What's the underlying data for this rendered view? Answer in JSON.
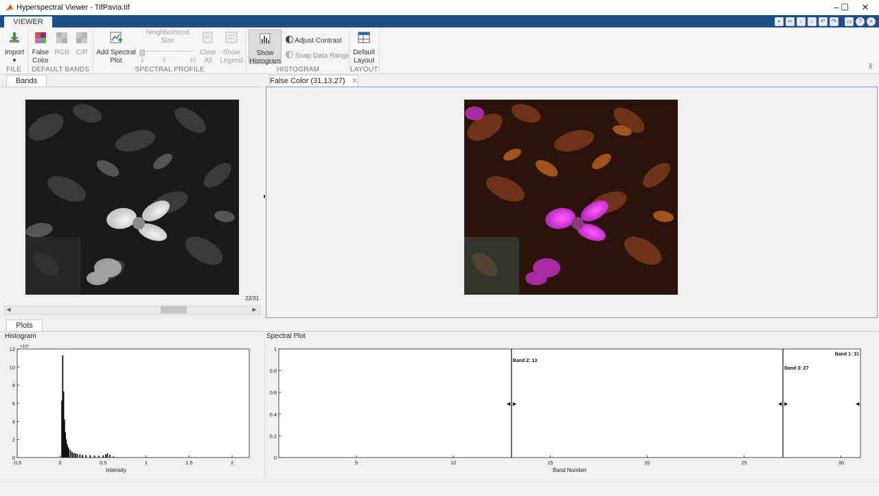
{
  "window": {
    "title": "Hyperspectral Viewer - TifPavia.tif",
    "controls": [
      "–",
      "☐",
      "✕"
    ]
  },
  "ribbon": {
    "tab": "VIEWER",
    "file": {
      "label": "FILE",
      "import_line1": "Import",
      "import_arrow": "▾"
    },
    "default_bands": {
      "label": "DEFAULT BANDS",
      "false_line1": "False",
      "false_line2": "Color",
      "rgb": "RGB",
      "cir": "CIR"
    },
    "spectral_profile": {
      "label": "SPECTRAL PROFILE",
      "add_line1": "Add Spectral",
      "add_line2": "Plot",
      "neigh_line1": "Neighborhood",
      "neigh_line2": "Size",
      "slider_ticks": [
        "1",
        "5",
        "10"
      ],
      "clear_line1": "Clear",
      "clear_line2": "All",
      "legend_line1": "Show",
      "legend_line2": "Legend"
    },
    "histogram": {
      "label": "HISTOGRAM",
      "show_line1": "Show",
      "show_line2": "Histogram",
      "adjust_contrast": "Adjust Contrast",
      "snap_range": "Snap Data Range"
    },
    "layout": {
      "label": "LAYOUT",
      "default_line1": "Default",
      "default_line2": "Layout"
    }
  },
  "bands_panel": {
    "tab": "Bands",
    "band_index": "22/31"
  },
  "false_color_panel": {
    "tab": "False Color (31,13,27)",
    "close": "✕"
  },
  "plots_panel": {
    "tab": "Plots",
    "histogram_title": "Histogram",
    "spectral_title": "Spectral Plot"
  },
  "chart_data": [
    {
      "type": "bar",
      "title": "Histogram",
      "xlabel": "Intensity",
      "ylabel": "",
      "y_exponent_label": "×10⁴",
      "xlim": [
        -0.5,
        2.2
      ],
      "ylim": [
        0,
        12
      ],
      "xticks": [
        "-0.5",
        "0",
        "0.5",
        "1",
        "1.5",
        "2"
      ],
      "yticks": [
        "0",
        "2",
        "4",
        "6",
        "8",
        "10",
        "12"
      ],
      "x": [
        0.02,
        0.03,
        0.04,
        0.05,
        0.06,
        0.07,
        0.08,
        0.09,
        0.1,
        0.12,
        0.14,
        0.16,
        0.18,
        0.2,
        0.23,
        0.26,
        0.3,
        0.35,
        0.4,
        0.45,
        0.5,
        0.53,
        0.55,
        0.58,
        0.62,
        0.66
      ],
      "values": [
        6.3,
        11.3,
        7.3,
        4.2,
        2.8,
        2.0,
        1.5,
        1.2,
        1.0,
        0.8,
        0.6,
        0.5,
        0.45,
        0.4,
        0.35,
        0.3,
        0.28,
        0.25,
        0.22,
        0.2,
        0.25,
        0.35,
        0.45,
        0.3,
        0.12,
        0.05
      ]
    },
    {
      "type": "line",
      "title": "Spectral Plot",
      "xlabel": "Band Number",
      "ylabel": "",
      "xlim": [
        1,
        31
      ],
      "ylim": [
        0,
        1
      ],
      "xticks": [
        "5",
        "10",
        "15",
        "20",
        "25",
        "30"
      ],
      "yticks": [
        "0",
        "0.2",
        "0.4",
        "0.6",
        "0.8",
        "1"
      ],
      "band_markers": [
        {
          "label": "Band 2: 13",
          "band": 13
        },
        {
          "label": "Band 3: 27",
          "band": 27
        },
        {
          "label": "Band 1: 31",
          "band": 31
        }
      ]
    }
  ],
  "colors": {
    "ribbon_tab_bar": "#1e4f84",
    "panel_border_active": "#7f9db9",
    "magenta_flower": "#d43ad6",
    "foliage": "#7a3b1c"
  }
}
